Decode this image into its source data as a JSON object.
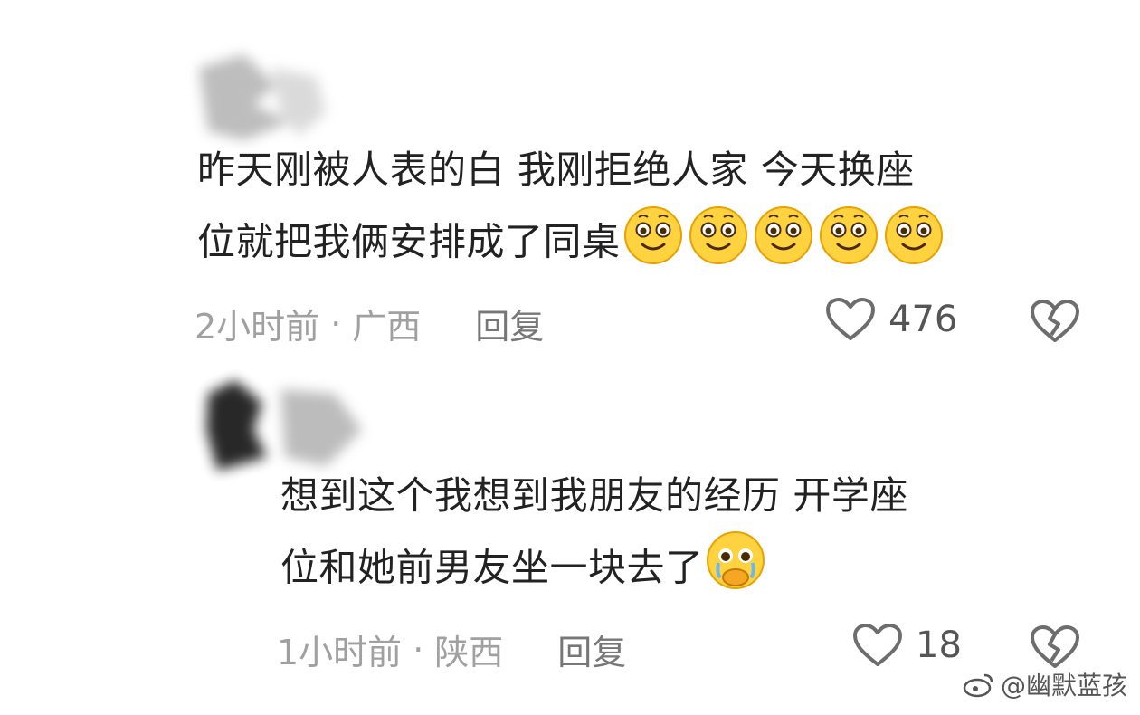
{
  "comments": [
    {
      "line1": "昨天刚被人表的白 我刚拒绝人家 今天换座",
      "line2": "位就把我俩安排成了同桌",
      "emoji_count": 5,
      "time": "2小时前",
      "location": "广西",
      "reply_label": "回复",
      "likes": "476"
    },
    {
      "line1": "想到这个我想到我朋友的经历 开学座",
      "line2": "位和她前男友坐一块去了",
      "time": "1小时前",
      "location": "陕西",
      "reply_label": "回复",
      "likes": "18"
    }
  ],
  "separator": "·",
  "watermark": "@幽默蓝孩",
  "icons": {
    "comment1_emoji": "smiley-face-icon",
    "comment2_emoji": "pleading-crying-face-icon",
    "like": "heart-outline-icon",
    "dislike": "broken-heart-icon",
    "watermark": "weibo-logo-icon"
  },
  "colors": {
    "text": "#222222",
    "meta": "#a0a0a0",
    "reply": "#777777",
    "emoji_yellow": "#FFD23F"
  }
}
